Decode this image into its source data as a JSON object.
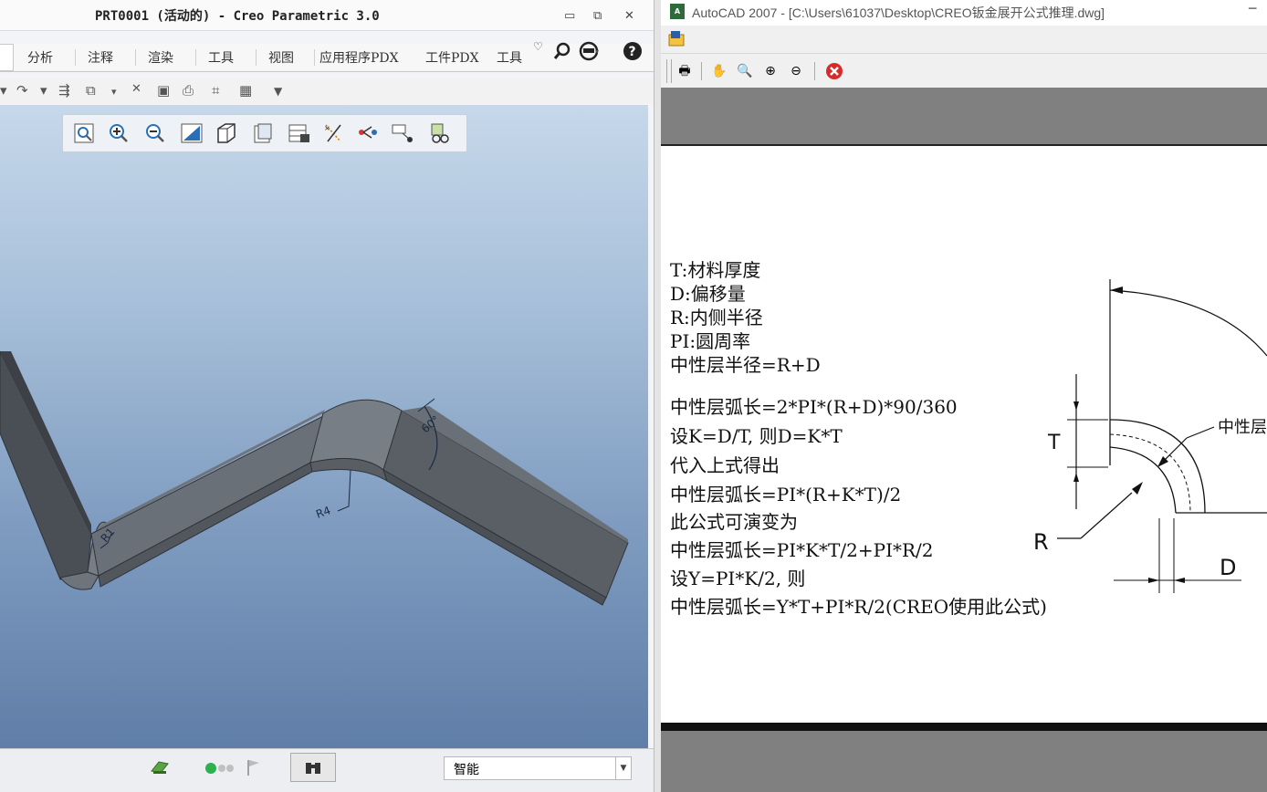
{
  "creo": {
    "title": "PRT0001 (活动的) - Creo Parametric 3.0",
    "window_controls": {
      "minimize": "▭",
      "restore": "⧉",
      "close": "✕"
    },
    "tabs": [
      "分析",
      "注释",
      "渲染",
      "工具",
      "视图",
      "应用程序PDX",
      "工件PDX",
      "工具"
    ],
    "model_labels": {
      "r1": "R1",
      "r4": "R4",
      "angle": "60°"
    },
    "status_bar": {
      "filter_value": "智能"
    }
  },
  "autocad": {
    "title": "AutoCAD 2007 - [C:\\Users\\61037\\Desktop\\CREO钣金展开公式推理.dwg]",
    "notes_group1": [
      "T:材料厚度",
      "D:偏移量",
      "R:内侧半径",
      "PI:圆周率",
      "中性层半径=R+D"
    ],
    "notes_group2": [
      "中性层弧长=2*PI*(R+D)*90/360",
      "设K=D/T, 则D=K*T",
      "代入上式得出",
      "中性层弧长=PI*(R+K*T)/2",
      "此公式可演变为",
      "中性层弧长=PI*K*T/2+PI*R/2",
      "设Y=PI*K/2, 则",
      "中性层弧长=Y*T+PI*R/2(CREO使用此公式)"
    ],
    "diagram_labels": {
      "r": "R",
      "d": "D",
      "t": "T",
      "neutral": "中性层"
    }
  }
}
